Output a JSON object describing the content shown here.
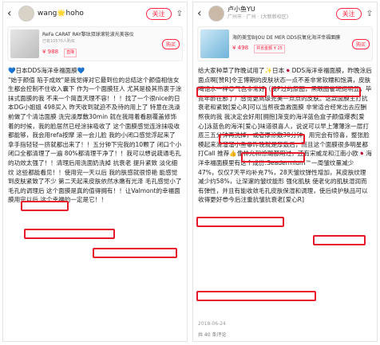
{
  "left": {
    "username": "wang🌟hoho",
    "follow_label": "关注",
    "product": {
      "name": "ReFa CARAT RAY黎珐双球滚轮波光美容仪",
      "sub": "已有10570人购买",
      "price": "¥ 988",
      "tag": "直降",
      "buy_label": "购买"
    },
    "paragraphs": [
      "💙日本DDS海洋幸福面膜💙",
      "\"始于颜值 陷于成效\"是我觉得对它最到位的总结这个颜值相信女生都会控制不住收入囊下 作为一个面膜狂人 尤其是极其热衷于涂抹式面膜的我 不来一个简直天理不容！！！找了一个很nice的日本DG小姐姐 498买入 昨天收到就迫不及待的用上了 特意在洗澡前做了个清洁面膜 洗完澡厚敷30min 就在我用着看剧覆盖修饰着的时候，我的脸居然已经涂抹吸收了 这个面膜感觉连涂抹吸收都能够，我会用refa按摩 滚一会儿脸 我的小闭口感觉浮起来了 拿手指轻轻一挤就都出来了！！五分钟下完我的10颗了 闭口个小闭口全都清理了一遍 80%都清理干净了！！我可以想说疏通毛孔的功效太强了！！清理后用洗面奶洗掉 抗衰老 提升紧致 淡化细纹 这些都能看见！！使用完一天以后 我的肤感就很惊艳 能感觉到皮肤紧致了不少 第二天起来皮肤依然水嫩有光泽 毛孔感觉小了 毛孔的调理后 这个面膜是真的值得拥有！！让Valmont的幸福面膜用完以后 这个幸福的一定是它！！"
    ]
  },
  "right": {
    "top_label": "小红书",
    "username": "卢小鱼YU",
    "location": "广州市 · 广州 · (大新新校区)",
    "follow_label": "关注",
    "product": {
      "name": "海的美宝BIJOU DE MER DDS抗氧化海洋幸福面膜",
      "sub": "",
      "price": "¥ 498",
      "tag": "共省金额 ¥ 25",
      "buy_label": "购买"
    },
    "paragraphs": [
      "给大家种草了昨晚试用了✨日本🇯🇵DDS海洋幸福面膜，昨晚涂后面点啊[赞R]令王博期的皮肤状态一点不差非常软糯和饱满，皮肤喝饱水一样😊气色非常好（没P过的原图，黑眼圈雀斑挺明显，毕竟年龄在那了）感觉更高级完美一点点的皮肤。这款面膜主打抗衰老和紧致[爱心R]可以当熬夜急救面膜 非常适合经常出去应酬熬夜的我 我决定会好用[拥抱]渐变的海洋蓝色盒子颜值爆表[爱心]泳蓝色的海洋[爱心]味道很喜人，说说可以早上薄薄涂一层打底三五分钟再洗掉，或者厚涂敷30分钟，用完会有惊喜，整张脸模起来滑溜溜小鱼😁昨晚就是厚敷后，而且这个面膜很多明星都打Call 推荐👍像林允和徐璐都用过，还有宋威龙和江南小欧🇯🇵海洋幸福面膜里有这个成份:Seadermium™一周皱纹量减少47%，仅仅7天平均补充7%，28天皱纹弹性增加，其皮肤纹理减少约58%，让深邃的皱纹能形 强化肌肤 使老化的肌肤湿润而有弹性，并且有能收敛毛孔皮肤保湿和调理，使后续护肤品可以收得更好😎今后注重抗皱抗衰老[爱心R]"
    ],
    "date": "2018-06-24",
    "comments": "共 40 条评论"
  }
}
